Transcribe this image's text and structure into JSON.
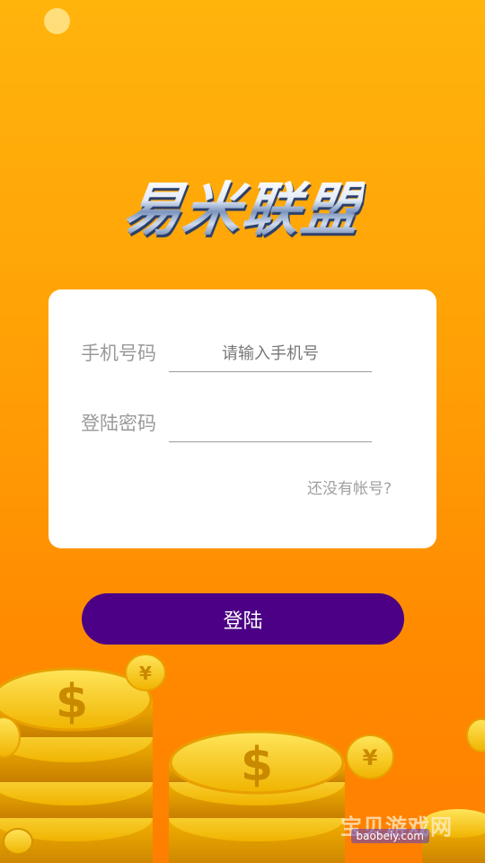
{
  "brand": {
    "logo_text": "易米联盟"
  },
  "form": {
    "phone_label": "手机号码",
    "phone_placeholder": "请输入手机号",
    "password_label": "登陆密码",
    "password_placeholder": "",
    "no_account_link": "还没有帐号?"
  },
  "actions": {
    "login_label": "登陆"
  },
  "watermark": {
    "text": "宝贝游戏网",
    "domain": "baobeiy.com"
  },
  "colors": {
    "background_top": "#ffb40c",
    "background_bottom": "#ff7f00",
    "button": "#4b0085",
    "card": "#ffffff"
  }
}
